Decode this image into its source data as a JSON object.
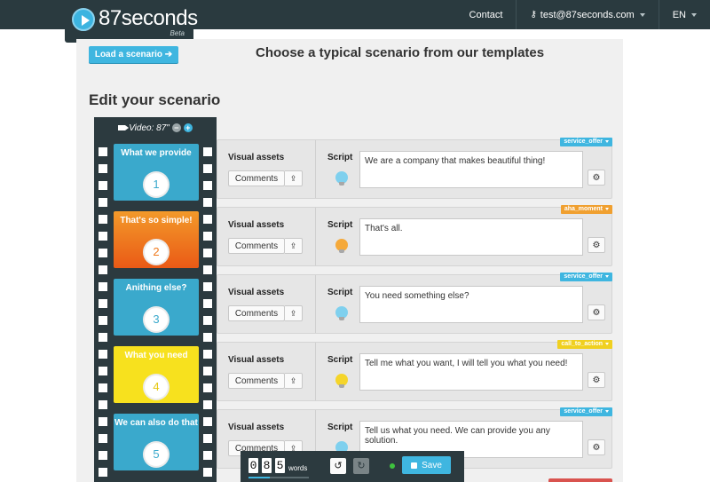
{
  "brand": {
    "name": "87seconds",
    "badge": "Beta"
  },
  "nav": {
    "contact": "Contact",
    "account": "test@87seconds.com",
    "language": "EN"
  },
  "header": {
    "load_button": "Load a scenario ➔",
    "templates_title": "Choose a typical scenario from our templates"
  },
  "editor": {
    "title": "Edit your scenario"
  },
  "film": {
    "label": "Video: 87\"",
    "minus": "−",
    "plus": "+",
    "frames": [
      {
        "title": "What we provide",
        "number": "1",
        "color": "#3aa9cc",
        "title_color": "#ffffff",
        "number_color": "#3aa9cc"
      },
      {
        "title": "That's so simple!",
        "number": "2",
        "color": "#f07a1e",
        "title_color": "#ffffff",
        "number_color": "#f07a1e"
      },
      {
        "title": "Anithing else?",
        "number": "3",
        "color": "#3aa9cc",
        "title_color": "#ffffff",
        "number_color": "#3aa9cc"
      },
      {
        "title": "What you need",
        "number": "4",
        "color": "#f7e11e",
        "title_color": "#ffffff",
        "number_color": "#e6c812"
      },
      {
        "title": "We can also do that",
        "number": "5",
        "color": "#3aa9cc",
        "title_color": "#ffffff",
        "number_color": "#3aa9cc"
      }
    ]
  },
  "rows": [
    {
      "visual_label": "Visual assets",
      "comments_label": "Comments",
      "script_label": "Script",
      "script_text": "We are a company that makes beautiful thing!",
      "tag": "service_offer",
      "tag_color": "#3fb6e0",
      "bulb_color": "#7fd0ee"
    },
    {
      "visual_label": "Visual assets",
      "comments_label": "Comments",
      "script_label": "Script",
      "script_text": "That's all.",
      "tag": "aha_moment",
      "tag_color": "#f0a030",
      "bulb_color": "#f5a93a"
    },
    {
      "visual_label": "Visual assets",
      "comments_label": "Comments",
      "script_label": "Script",
      "script_text": "You need something else?",
      "tag": "service_offer",
      "tag_color": "#3fb6e0",
      "bulb_color": "#7fd0ee"
    },
    {
      "visual_label": "Visual assets",
      "comments_label": "Comments",
      "script_label": "Script",
      "script_text": "Tell me what you want, I will tell you what you need!",
      "tag": "call_to_action",
      "tag_color": "#f0d020",
      "bulb_color": "#f5d52a"
    },
    {
      "visual_label": "Visual assets",
      "comments_label": "Comments",
      "script_label": "Script",
      "script_text": "Tell us what you need. We can provide you any solution.",
      "tag": "service_offer",
      "tag_color": "#3fb6e0",
      "bulb_color": "#7fd0ee"
    }
  ],
  "toolbar": {
    "digits": [
      "0",
      "8",
      "5"
    ],
    "words_label": "words",
    "progress_percent": 35,
    "undo": "↺",
    "redo": "↻",
    "save_label": "Save"
  },
  "colors": {
    "accent": "#3fb6e0",
    "dark": "#2c3a3f",
    "panel": "#f0f0f0"
  }
}
